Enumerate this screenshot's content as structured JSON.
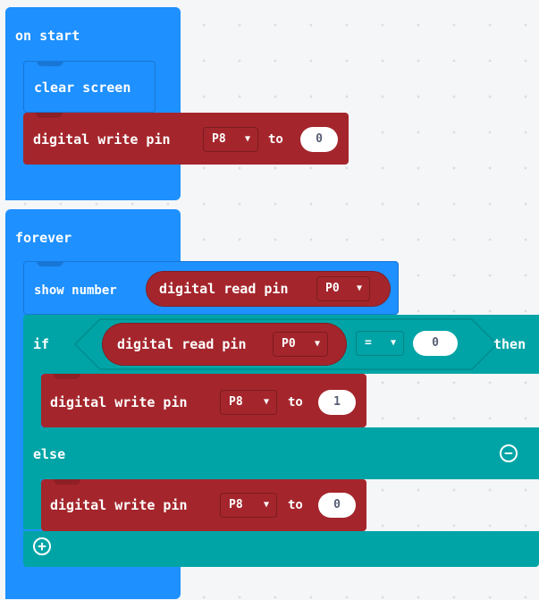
{
  "on_start": {
    "label": "on start",
    "clear_screen": "clear screen",
    "digital_write": {
      "label": "digital write pin",
      "pin": "P8",
      "to": "to",
      "value": "0"
    }
  },
  "forever": {
    "label": "forever",
    "show_number": {
      "label": "show number",
      "reporter": "digital read pin",
      "pin": "P0"
    },
    "if_block": {
      "if_label": "if",
      "condition": {
        "reporter": "digital read pin",
        "pin": "P0",
        "operator": "=",
        "value": "0"
      },
      "then_label": "then",
      "then_write": {
        "label": "digital write pin",
        "pin": "P8",
        "to": "to",
        "value": "1"
      },
      "else_label": "else",
      "else_write": {
        "label": "digital write pin",
        "pin": "P8",
        "to": "to",
        "value": "0"
      }
    }
  }
}
